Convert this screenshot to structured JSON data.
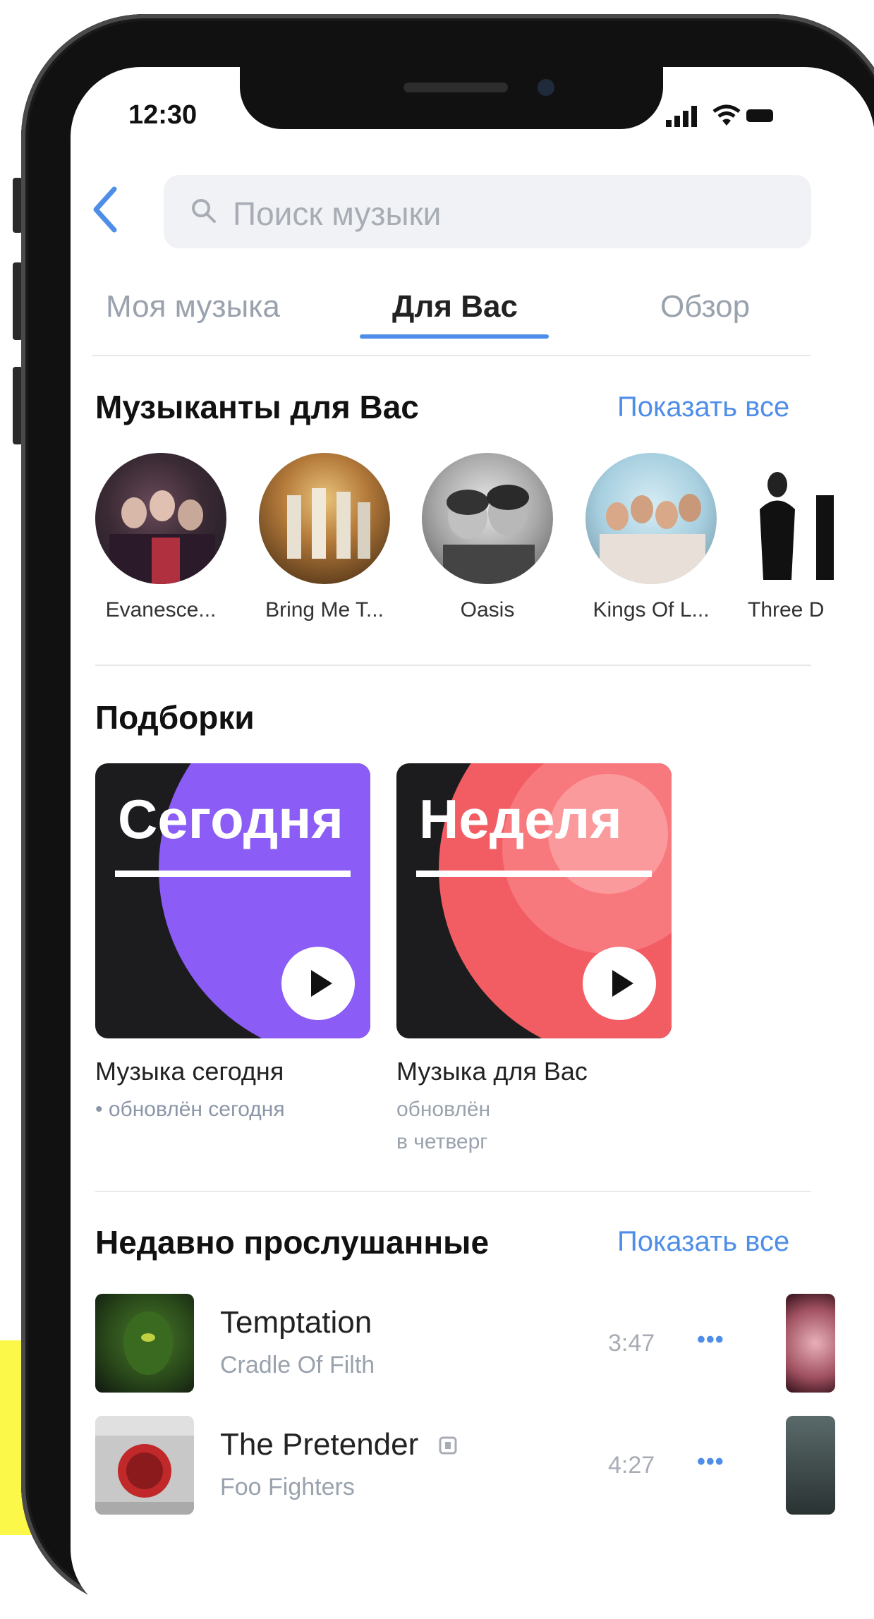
{
  "status_bar": {
    "time": "12:30"
  },
  "search": {
    "placeholder": "Поиск музыки"
  },
  "tabs": [
    {
      "label": "Моя музыка"
    },
    {
      "label": "Для Вас",
      "active": true
    },
    {
      "label": "Обзор"
    }
  ],
  "artists_section": {
    "title": "Музыканты для Вас",
    "show_all": "Показать все",
    "artists": [
      {
        "name": "Evanesce..."
      },
      {
        "name": "Bring Me T..."
      },
      {
        "name": "Oasis"
      },
      {
        "name": "Kings Of L..."
      },
      {
        "name": "Three D"
      }
    ]
  },
  "collections_section": {
    "title": "Подборки",
    "playlists": [
      {
        "cover_title": "Сегодня",
        "title": "Музыка сегодня",
        "subtitle": "• обновлён сегодня",
        "accent": "#8b5cf6"
      },
      {
        "cover_title": "Неделя",
        "title": "Музыка для Вас",
        "subtitle_line1": "обновлён",
        "subtitle_line2": "в четверг",
        "accent": "#f25c63"
      }
    ]
  },
  "recent_section": {
    "title": "Недавно прослушанные",
    "show_all": "Показать все",
    "tracks": [
      {
        "title": "Temptation",
        "artist": "Cradle Of Filth",
        "duration": "3:47",
        "more": "•••"
      },
      {
        "title": "The Pretender",
        "artist": "Foo Fighters",
        "duration": "4:27",
        "more": "•••"
      }
    ]
  },
  "colors": {
    "accent": "#4f8ee8",
    "muted_text": "#99a2ad",
    "search_bg": "#f1f2f5"
  }
}
